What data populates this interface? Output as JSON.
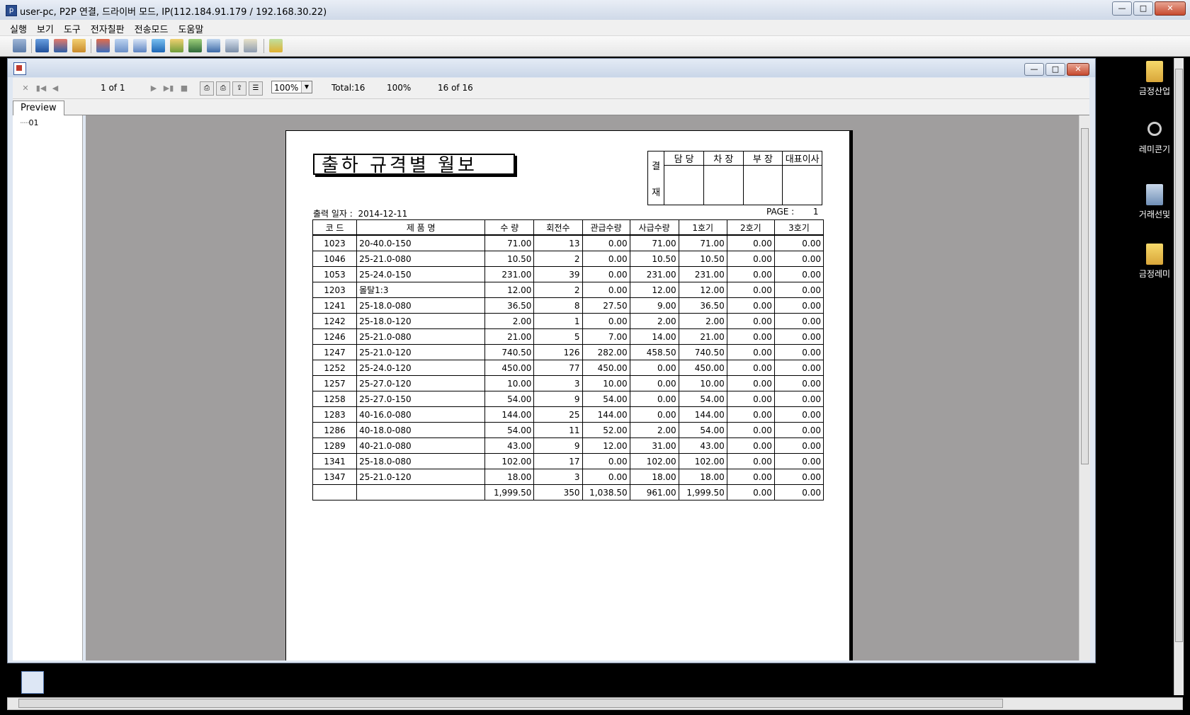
{
  "window": {
    "title": "user-pc, P2P 연결, 드라이버 모드, IP(112.184.91.179 / 192.168.30.22)",
    "icon_letter": "p"
  },
  "menu": [
    "실행",
    "보기",
    "도구",
    "전자칠판",
    "전송모드",
    "도움말"
  ],
  "report_toolbar": {
    "page_label": "1 of 1",
    "zoom": "100%",
    "total": "Total:16",
    "percent": "100%",
    "count": "16 of 16"
  },
  "tab": {
    "label": "Preview"
  },
  "tree": {
    "item": "01"
  },
  "report": {
    "title": "출하 규격별 월보",
    "approval": {
      "side": [
        "결",
        "재"
      ],
      "headers": [
        "담 당",
        "차 장",
        "부 장",
        "대표이사"
      ]
    },
    "print_date_label": "출력 일자 :",
    "print_date": "2014-12-11",
    "page_label": "PAGE :",
    "page_value": "1",
    "columns": [
      "코 드",
      "제   품   명",
      "수 량",
      "회전수",
      "관급수량",
      "사급수량",
      "1호기",
      "2호기",
      "3호기"
    ],
    "rows": [
      [
        "1023",
        "20-40.0-150",
        "71.00",
        "13",
        "0.00",
        "71.00",
        "71.00",
        "0.00",
        "0.00"
      ],
      [
        "1046",
        "25-21.0-080",
        "10.50",
        "2",
        "0.00",
        "10.50",
        "10.50",
        "0.00",
        "0.00"
      ],
      [
        "1053",
        "25-24.0-150",
        "231.00",
        "39",
        "0.00",
        "231.00",
        "231.00",
        "0.00",
        "0.00"
      ],
      [
        "1203",
        "몰탈1:3",
        "12.00",
        "2",
        "0.00",
        "12.00",
        "12.00",
        "0.00",
        "0.00"
      ],
      [
        "1241",
        "25-18.0-080",
        "36.50",
        "8",
        "27.50",
        "9.00",
        "36.50",
        "0.00",
        "0.00"
      ],
      [
        "1242",
        "25-18.0-120",
        "2.00",
        "1",
        "0.00",
        "2.00",
        "2.00",
        "0.00",
        "0.00"
      ],
      [
        "1246",
        "25-21.0-080",
        "21.00",
        "5",
        "7.00",
        "14.00",
        "21.00",
        "0.00",
        "0.00"
      ],
      [
        "1247",
        "25-21.0-120",
        "740.50",
        "126",
        "282.00",
        "458.50",
        "740.50",
        "0.00",
        "0.00"
      ],
      [
        "1252",
        "25-24.0-120",
        "450.00",
        "77",
        "450.00",
        "0.00",
        "450.00",
        "0.00",
        "0.00"
      ],
      [
        "1257",
        "25-27.0-120",
        "10.00",
        "3",
        "10.00",
        "0.00",
        "10.00",
        "0.00",
        "0.00"
      ],
      [
        "1258",
        "25-27.0-150",
        "54.00",
        "9",
        "54.00",
        "0.00",
        "54.00",
        "0.00",
        "0.00"
      ],
      [
        "1283",
        "40-16.0-080",
        "144.00",
        "25",
        "144.00",
        "0.00",
        "144.00",
        "0.00",
        "0.00"
      ],
      [
        "1286",
        "40-18.0-080",
        "54.00",
        "11",
        "52.00",
        "2.00",
        "54.00",
        "0.00",
        "0.00"
      ],
      [
        "1289",
        "40-21.0-080",
        "43.00",
        "9",
        "12.00",
        "31.00",
        "43.00",
        "0.00",
        "0.00"
      ],
      [
        "1341",
        "25-18.0-080",
        "102.00",
        "17",
        "0.00",
        "102.00",
        "102.00",
        "0.00",
        "0.00"
      ],
      [
        "1347",
        "25-21.0-120",
        "18.00",
        "3",
        "0.00",
        "18.00",
        "18.00",
        "0.00",
        "0.00"
      ]
    ],
    "totals": [
      "",
      "",
      "1,999.50",
      "350",
      "1,038.50",
      "961.00",
      "1,999.50",
      "0.00",
      "0.00"
    ]
  },
  "desktop_icons": [
    "금정산업",
    "레미콘기",
    "거래선및",
    "금정레미"
  ],
  "colors": {
    "preview_bg": "#a09e9e",
    "title_gradient_top": "#e9eef6",
    "close_button": "#c74a2f"
  }
}
